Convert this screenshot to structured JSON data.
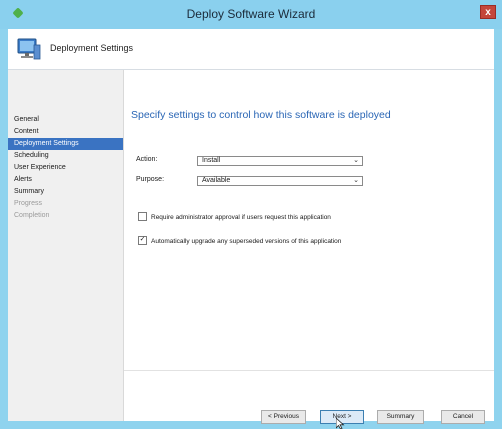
{
  "window": {
    "title": "Deploy Software Wizard",
    "close_label": "x"
  },
  "header": {
    "title": "Deployment Settings"
  },
  "sidebar": {
    "items": [
      {
        "label": "General",
        "state": "normal"
      },
      {
        "label": "Content",
        "state": "normal"
      },
      {
        "label": "Deployment Settings",
        "state": "active"
      },
      {
        "label": "Scheduling",
        "state": "normal"
      },
      {
        "label": "User Experience",
        "state": "normal"
      },
      {
        "label": "Alerts",
        "state": "normal"
      },
      {
        "label": "Summary",
        "state": "normal"
      },
      {
        "label": "Progress",
        "state": "disabled"
      },
      {
        "label": "Completion",
        "state": "disabled"
      }
    ]
  },
  "main": {
    "heading": "Specify settings to control how this software is deployed",
    "action": {
      "label": "Action:",
      "value": "Install"
    },
    "purpose": {
      "label": "Purpose:",
      "value": "Available"
    },
    "require_approval": {
      "label": "Require administrator approval if users request this application",
      "checked": false
    },
    "auto_upgrade": {
      "label": "Automatically upgrade any superseded versions of this application",
      "checked": true
    }
  },
  "buttons": {
    "previous": "< Previous",
    "next": "Next >",
    "summary": "Summary",
    "cancel": "Cancel"
  },
  "colors": {
    "accent": "#3a73c2",
    "heading": "#2a66b5",
    "window_frame": "#8fd3ee"
  }
}
